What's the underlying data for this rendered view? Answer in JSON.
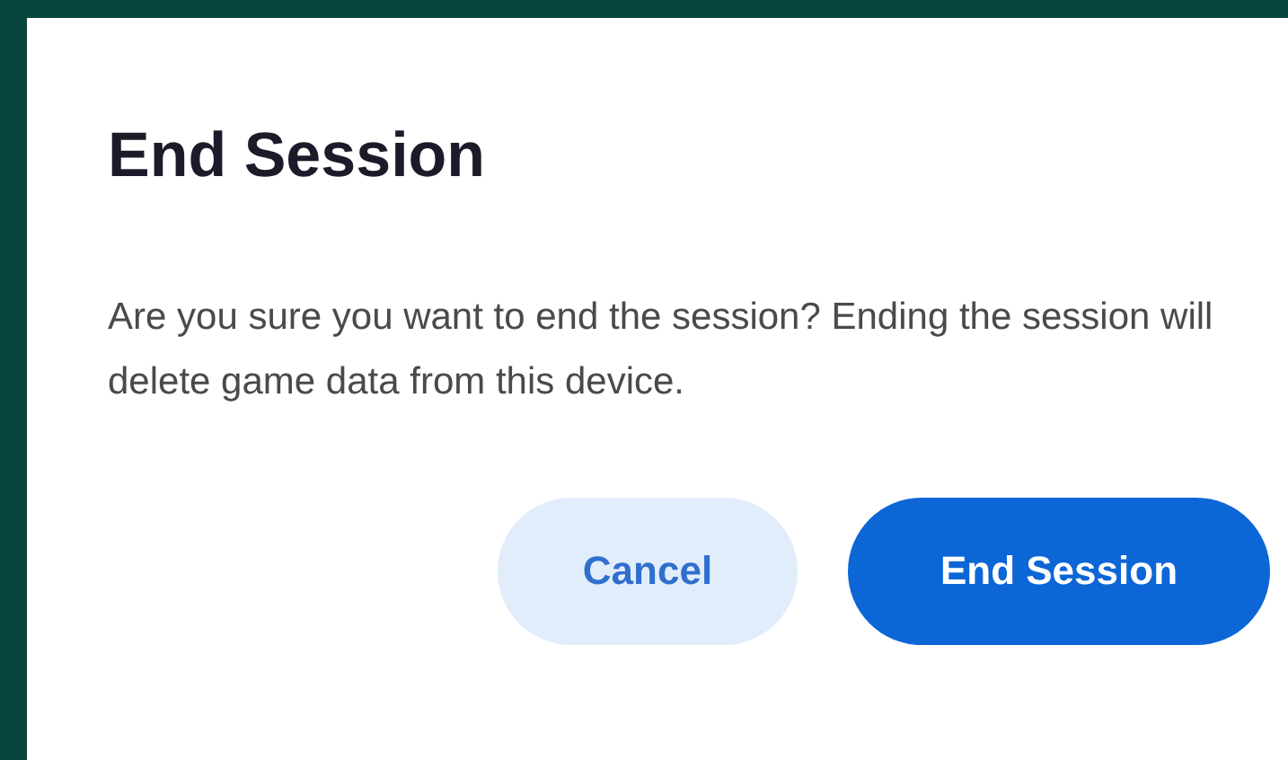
{
  "dialog": {
    "title": "End Session",
    "message": "Are you sure you want to end the session? Ending the session will delete game data from this device.",
    "buttons": [
      {
        "label": "Cancel",
        "kind": "secondary"
      },
      {
        "label": "End Session",
        "kind": "primary"
      }
    ]
  }
}
